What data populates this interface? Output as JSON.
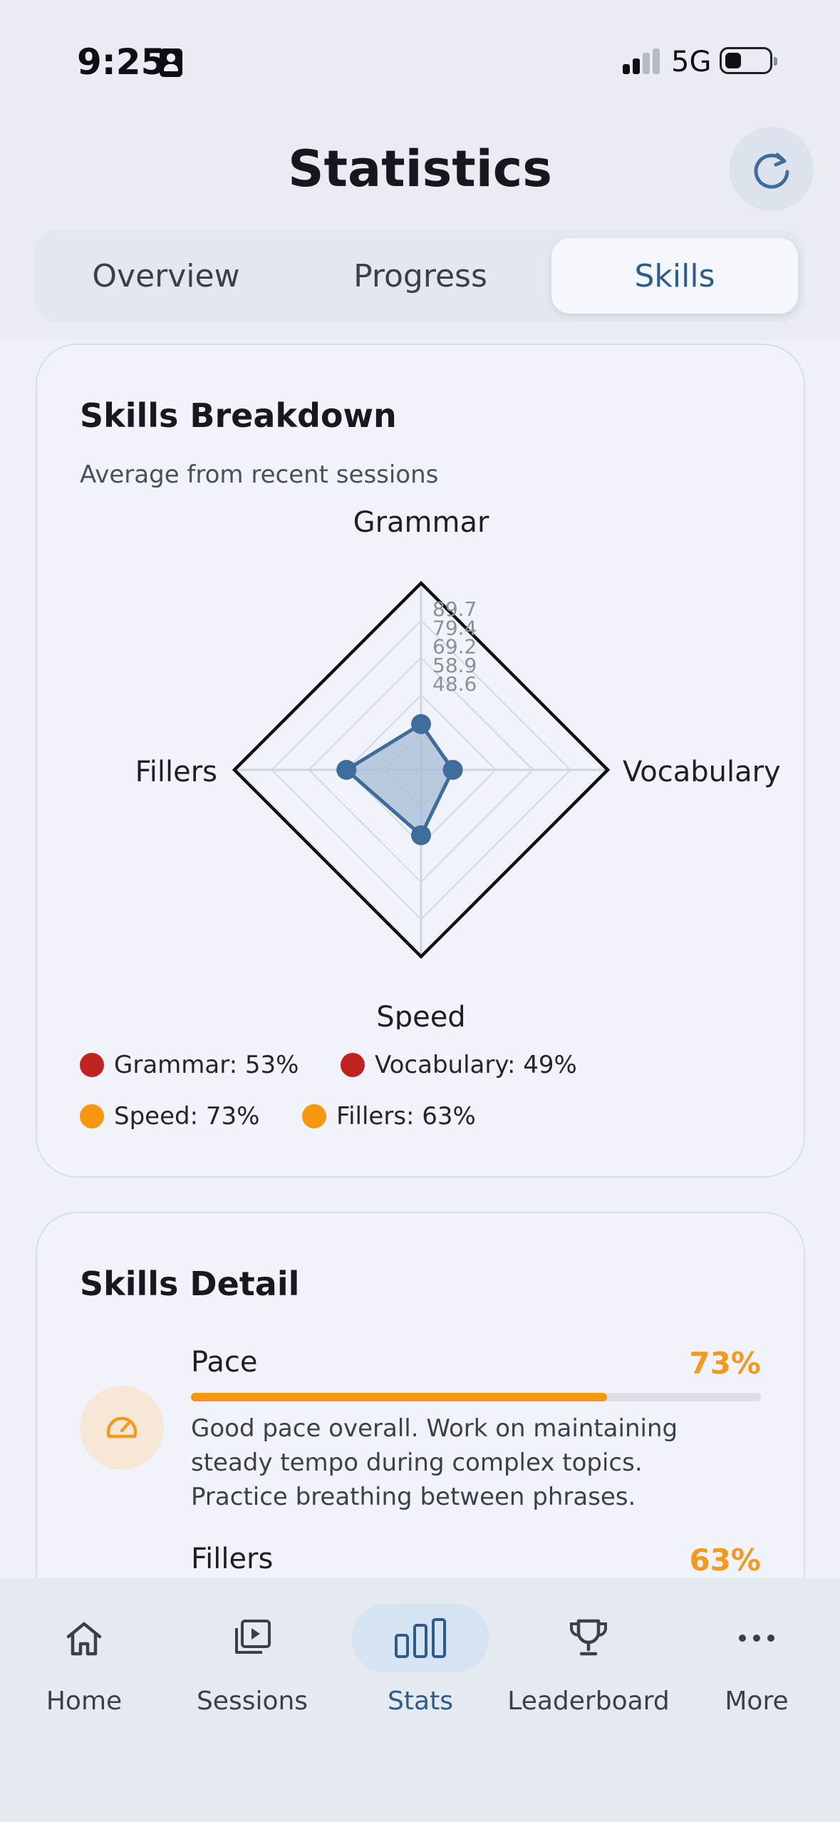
{
  "status_bar": {
    "time": "9:25",
    "network": "5G"
  },
  "header": {
    "title": "Statistics",
    "refresh_icon": "refresh-icon"
  },
  "tabs": [
    {
      "label": "Overview",
      "active": false
    },
    {
      "label": "Progress",
      "active": false
    },
    {
      "label": "Skills",
      "active": true
    }
  ],
  "skills_breakdown": {
    "title": "Skills Breakdown",
    "subtitle": "Average from recent sessions",
    "chart_data": {
      "type": "radar",
      "axes": [
        "Grammar",
        "Vocabulary",
        "Speed",
        "Fillers"
      ],
      "values": [
        53,
        49,
        73,
        63
      ],
      "max": 100,
      "tick_labels": [
        "89.7",
        "79.4",
        "69.2",
        "58.9",
        "48.6"
      ],
      "series_color": "#3e6c9b",
      "fill_color": "#a7bcd6"
    },
    "legend": [
      {
        "text": "Grammar: 53%",
        "color": "#c0221f"
      },
      {
        "text": "Vocabulary: 49%",
        "color": "#c0221f"
      },
      {
        "text": "Speed: 73%",
        "color": "#f7960f"
      },
      {
        "text": "Fillers: 63%",
        "color": "#f7960f"
      }
    ]
  },
  "skills_detail": {
    "title": "Skills Detail",
    "items": [
      {
        "name": "Pace",
        "percent": "73%",
        "progress": 0.73,
        "icon": "speedometer-icon",
        "description_lines": [
          "Good pace overall. Work on maintaining",
          "steady tempo during complex topics.",
          "Practice breathing between phrases."
        ]
      },
      {
        "name": "Fillers",
        "percent": "63%",
        "progress": 0.63
      }
    ]
  },
  "bottom_nav": [
    {
      "label": "Home",
      "icon": "home-icon",
      "active": false
    },
    {
      "label": "Sessions",
      "icon": "sessions-icon",
      "active": false
    },
    {
      "label": "Stats",
      "icon": "bar-chart-icon",
      "active": true
    },
    {
      "label": "Leaderboard",
      "icon": "trophy-icon",
      "active": false
    },
    {
      "label": "More",
      "icon": "more-icon",
      "active": false
    }
  ],
  "colors": {
    "accent": "#2c5b8c",
    "warning": "#f7960f",
    "danger": "#c0221f"
  }
}
